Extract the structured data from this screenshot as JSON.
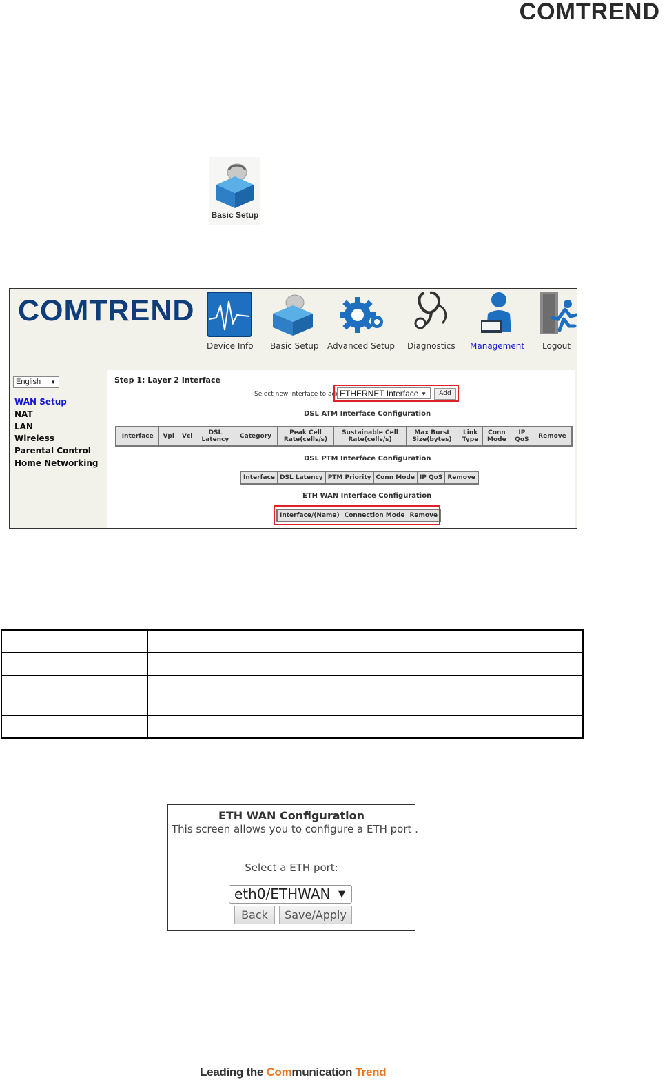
{
  "header": {
    "brand": "COMTREND"
  },
  "basic_setup_icon": {
    "label": "Basic Setup"
  },
  "router_ui": {
    "logo": "COMTREND",
    "nav": [
      {
        "label": "Device Info",
        "icon": "device-info-icon"
      },
      {
        "label": "Basic Setup",
        "icon": "basic-setup-icon"
      },
      {
        "label": "Advanced Setup",
        "icon": "gear-icon"
      },
      {
        "label": "Diagnostics",
        "icon": "stethoscope-icon"
      },
      {
        "label": "Management",
        "icon": "management-icon",
        "active": true
      },
      {
        "label": "Logout",
        "icon": "logout-icon"
      }
    ],
    "language": "English",
    "sidebar": [
      "WAN Setup",
      "NAT",
      "LAN",
      "Wireless",
      "Parental Control",
      "Home Networking"
    ],
    "step_title": "Step 1: Layer 2 Interface",
    "select_label": "Select new interface to add:",
    "selected_interface": "ETHERNET Interface",
    "add_label": "Add",
    "atm_title": "DSL ATM Interface Configuration",
    "atm_headers": [
      [
        "Interface"
      ],
      [
        "Vpi"
      ],
      [
        "Vci"
      ],
      [
        "DSL",
        "Latency"
      ],
      [
        "Category"
      ],
      [
        "Peak Cell",
        "Rate(cells/s)"
      ],
      [
        "Sustainable Cell",
        "Rate(cells/s)"
      ],
      [
        "Max Burst",
        "Size(bytes)"
      ],
      [
        "Link",
        "Type"
      ],
      [
        "Conn",
        "Mode"
      ],
      [
        "IP",
        "QoS"
      ],
      [
        "Remove"
      ]
    ],
    "ptm_title": "DSL PTM Interface Configuration",
    "ptm_headers": [
      "Interface",
      "DSL Latency",
      "PTM Priority",
      "Conn Mode",
      "IP QoS",
      "Remove"
    ],
    "eth_title": "ETH WAN Interface Configuration",
    "eth_headers": [
      "Interface/(Name)",
      "Connection Mode",
      "Remove"
    ]
  },
  "dialog": {
    "title": "ETH WAN Configuration",
    "description": "This screen allows you to configure a ETH port .",
    "port_label": "Select a ETH port:",
    "port_value": "eth0/ETHWAN",
    "back_label": "Back",
    "apply_label": "Save/Apply"
  },
  "footer": {
    "part1": "Leading the ",
    "part2": "Com",
    "part3": "munication ",
    "part4": "Trend"
  }
}
